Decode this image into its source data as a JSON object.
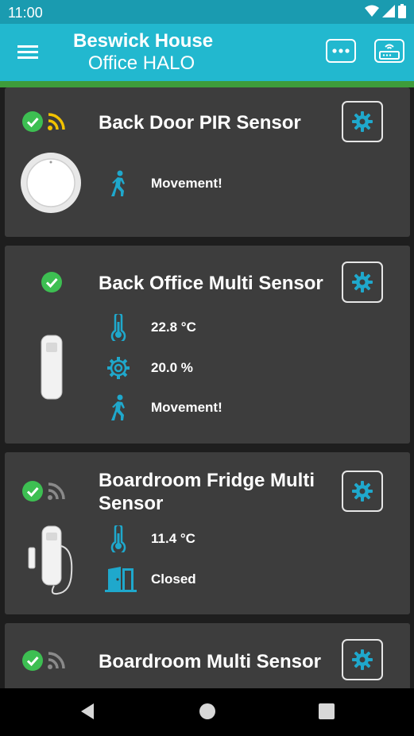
{
  "status_bar": {
    "time": "11:00"
  },
  "header": {
    "title_line1": "Beswick House",
    "title_line2": "Office HALO",
    "menu_icon": "hamburger-menu-icon",
    "more_icon": "more-dots-icon",
    "hub_icon": "router-hub-icon"
  },
  "colors": {
    "primary": "#22b8cf",
    "status_bar": "#1a9bb0",
    "accent_green": "#3e9c3a",
    "ok_green": "#3dbf52",
    "signal_yellow": "#f2c200",
    "signal_grey": "#8a8a8a",
    "card_bg": "#3d3d3d",
    "icon_blue": "#1fa8cc"
  },
  "devices": [
    {
      "name": "Back Door PIR Sensor",
      "signal": "strong",
      "readings": [
        {
          "icon": "walking-person-icon",
          "text": "Movement!"
        }
      ]
    },
    {
      "name": "Back Office Multi Sensor",
      "signal": "none",
      "readings": [
        {
          "icon": "thermometer-icon",
          "text": "22.8 °C"
        },
        {
          "icon": "gear-humidity-icon",
          "text": "20.0 %"
        },
        {
          "icon": "walking-person-icon",
          "text": "Movement!"
        }
      ]
    },
    {
      "name": "Boardroom Fridge Multi Sensor",
      "signal": "weak",
      "readings": [
        {
          "icon": "thermometer-icon",
          "text": "11.4 °C"
        },
        {
          "icon": "open-door-icon",
          "text": "Closed"
        }
      ]
    },
    {
      "name": "Boardroom Multi Sensor",
      "signal": "weak",
      "readings": []
    }
  ]
}
